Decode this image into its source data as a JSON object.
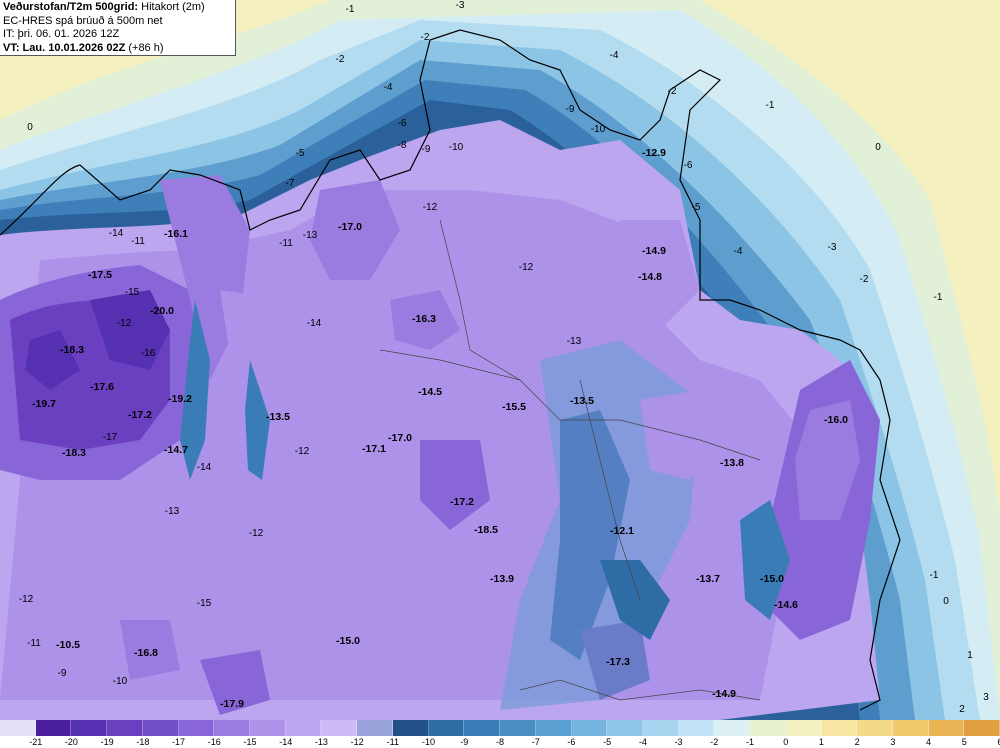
{
  "header": {
    "line1_bold": "Veðurstofan/T2m 500grid:",
    "line1_rest": " Hitakort (2m)",
    "line2": "EC-HRES spá brúuð á 500m net",
    "line3": "IT: þri. 06. 01. 2026 12Z",
    "line4_bold": "VT: Lau. 10.01.2026 02Z",
    "line4_rest": " (+86 h)"
  },
  "colorbar": {
    "labels": [
      "-21",
      "-20",
      "-19",
      "-18",
      "-17",
      "-16",
      "-15",
      "-14",
      "-13",
      "-12",
      "-11",
      "-10",
      "-9",
      "-8",
      "-7",
      "-6",
      "-5",
      "-4",
      "-3",
      "-2",
      "-1",
      "0",
      "1",
      "2",
      "3",
      "4",
      "5",
      "6"
    ],
    "colors": [
      "#e4e0f8",
      "#4a1e9e",
      "#5530b0",
      "#6a40c0",
      "#7050c8",
      "#8866d8",
      "#9a7ce0",
      "#ad92ea",
      "#bda6f0",
      "#cdbaf6",
      "#9aa2dc",
      "#21508a",
      "#2e6ca6",
      "#3a7cb6",
      "#4a8ec4",
      "#5aa0d2",
      "#74b4de",
      "#8ec6e8",
      "#a8d6f0",
      "#c2e4f6",
      "#ddf0f4",
      "#e6f2d0",
      "#f4f2c0",
      "#f6e6a2",
      "#f4da88",
      "#f0ca6c",
      "#e8b454",
      "#e0a040"
    ]
  },
  "map_labels": {
    "big": [
      "-16.1",
      "-17.5",
      "-20.0",
      "-18.3",
      "-17.6",
      "-19.7",
      "-17.2",
      "-19.2",
      "-18.3",
      "-14.7",
      "-13.5",
      "-17.0",
      "-16.3",
      "-14.5",
      "-17.0",
      "-17.1",
      "-15.5",
      "-13.5",
      "-14.9",
      "-14.8",
      "-12.9",
      "-17.2",
      "-18.5",
      "-13.9",
      "-12.1",
      "-13.8",
      "-16.0",
      "-13.7",
      "-15.0",
      "-14.6",
      "-10.5",
      "-16.8",
      "-15.0",
      "-17.3",
      "-14.9",
      "-17.9"
    ],
    "contour": [
      "-3",
      "-2",
      "-1",
      "0",
      "-2",
      "-4",
      "-5",
      "-6",
      "-8",
      "-9",
      "-10",
      "-12",
      "-11",
      "-13",
      "-14",
      "-15",
      "-16",
      "-17",
      "-7",
      "-4",
      "-2",
      "-1",
      "0",
      "-1",
      "-2",
      "-3",
      "-4",
      "-5",
      "-6",
      "-9",
      "-10",
      "-12",
      "-11",
      "-12",
      "-13",
      "-14",
      "-12",
      "-12",
      "-13",
      "-14",
      "-15",
      "-12",
      "-11",
      "-10",
      "-9",
      "-1",
      "0",
      "1",
      "2",
      "3"
    ]
  }
}
